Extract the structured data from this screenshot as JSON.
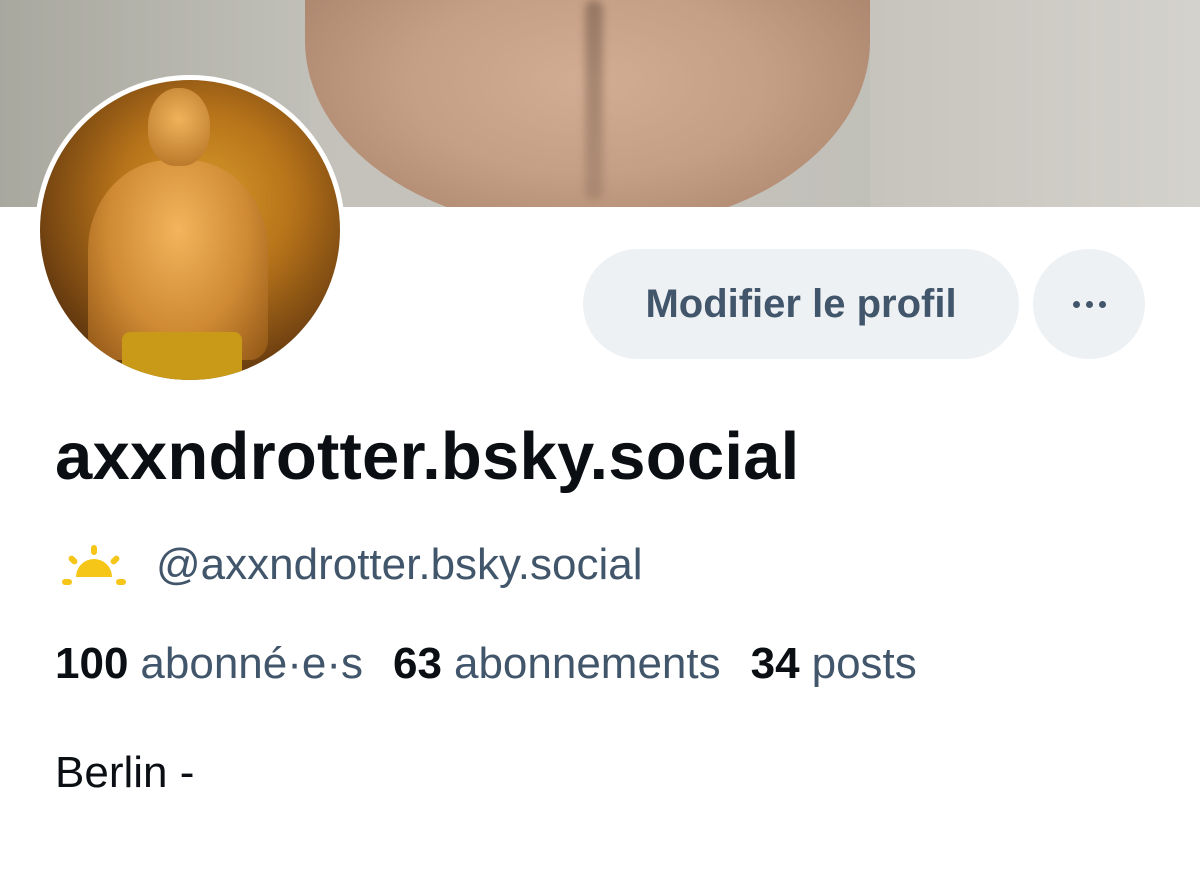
{
  "profile": {
    "display_name": "axxndrotter.bsky.social",
    "handle": "@axxndrotter.bsky.social",
    "status_icon": "sunrise-icon",
    "bio": "Berlin -"
  },
  "actions": {
    "edit_profile_label": "Modifier le profil",
    "more_icon": "more-horizontal-icon"
  },
  "stats": [
    {
      "value": "100",
      "label": "abonné·e·s"
    },
    {
      "value": "63",
      "label": "abonnements"
    },
    {
      "value": "34",
      "label": "posts"
    }
  ],
  "colors": {
    "text_primary": "#0b0f14",
    "text_secondary": "#42566b",
    "button_bg": "#eef1f4",
    "sun_icon": "#f5c518"
  }
}
